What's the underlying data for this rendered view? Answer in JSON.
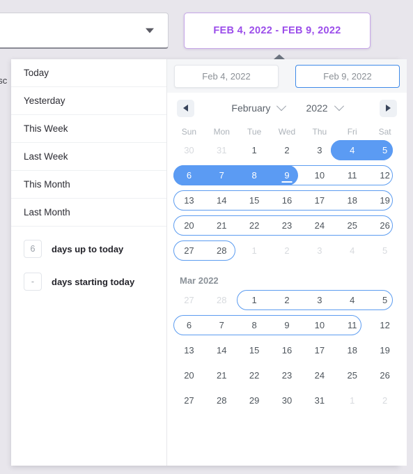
{
  "background": {
    "select_caret_icon": "chevron-down-icon",
    "obscured_text": "esc",
    "range_badge_label": "FEB 4, 2022 - FEB 9, 2022",
    "badge_accent_color": "#9b4dea"
  },
  "popup": {
    "presets": [
      {
        "label": "Today"
      },
      {
        "label": "Yesterday"
      },
      {
        "label": "This Week"
      },
      {
        "label": "Last Week"
      },
      {
        "label": "This Month"
      },
      {
        "label": "Last Month"
      }
    ],
    "relative_rows": [
      {
        "value": "6",
        "label": "days up to today"
      },
      {
        "value": "-",
        "label": "days starting today"
      }
    ],
    "date_fields": {
      "start": {
        "value": "Feb 4, 2022",
        "active": false
      },
      "end": {
        "value": "Feb 9, 2022",
        "active": true
      }
    },
    "nav": {
      "prev_icon": "chevron-left-icon",
      "next_icon": "chevron-right-icon",
      "month": "February",
      "year": "2022",
      "month_chevron_icon": "chevron-down-icon",
      "year_chevron_icon": "chevron-down-icon"
    },
    "weekdays": [
      "Sun",
      "Mon",
      "Tue",
      "Wed",
      "Thu",
      "Fri",
      "Sat"
    ],
    "accent_selected": "#5b9bf3",
    "accent_ring": "#5c9cf0",
    "months": [
      {
        "title": "",
        "weeks": [
          {
            "days": [
              {
                "n": "30",
                "muted": true
              },
              {
                "n": "31",
                "muted": true
              },
              {
                "n": "1"
              },
              {
                "n": "2"
              },
              {
                "n": "3"
              },
              {
                "n": "4",
                "selected": true
              },
              {
                "n": "5",
                "selected": true
              }
            ],
            "fill": {
              "from": 5,
              "to": 6
            },
            "ring": {
              "from": 5,
              "to": 6
            }
          },
          {
            "days": [
              {
                "n": "6",
                "selected": true
              },
              {
                "n": "7",
                "selected": true
              },
              {
                "n": "8",
                "selected": true
              },
              {
                "n": "9",
                "selected": true,
                "today": true
              },
              {
                "n": "10"
              },
              {
                "n": "11"
              },
              {
                "n": "12"
              }
            ],
            "fill": {
              "from": 0,
              "to": 3
            },
            "ring": {
              "from": 0,
              "to": 6
            }
          },
          {
            "days": [
              {
                "n": "13"
              },
              {
                "n": "14"
              },
              {
                "n": "15"
              },
              {
                "n": "16"
              },
              {
                "n": "17"
              },
              {
                "n": "18"
              },
              {
                "n": "19"
              }
            ],
            "ring": {
              "from": 0,
              "to": 6
            }
          },
          {
            "days": [
              {
                "n": "20"
              },
              {
                "n": "21"
              },
              {
                "n": "22"
              },
              {
                "n": "23"
              },
              {
                "n": "24"
              },
              {
                "n": "25"
              },
              {
                "n": "26"
              }
            ],
            "ring": {
              "from": 0,
              "to": 6
            }
          },
          {
            "days": [
              {
                "n": "27"
              },
              {
                "n": "28"
              },
              {
                "n": "1",
                "muted": true
              },
              {
                "n": "2",
                "muted": true
              },
              {
                "n": "3",
                "muted": true
              },
              {
                "n": "4",
                "muted": true
              },
              {
                "n": "5",
                "muted": true
              }
            ],
            "ring": {
              "from": 0,
              "to": 1
            }
          }
        ]
      },
      {
        "title": "Mar 2022",
        "weeks": [
          {
            "days": [
              {
                "n": "27",
                "muted": true
              },
              {
                "n": "28",
                "muted": true
              },
              {
                "n": "1"
              },
              {
                "n": "2"
              },
              {
                "n": "3"
              },
              {
                "n": "4"
              },
              {
                "n": "5"
              }
            ],
            "ring": {
              "from": 2,
              "to": 6
            }
          },
          {
            "days": [
              {
                "n": "6"
              },
              {
                "n": "7"
              },
              {
                "n": "8"
              },
              {
                "n": "9"
              },
              {
                "n": "10"
              },
              {
                "n": "11"
              },
              {
                "n": "12"
              }
            ],
            "ring": {
              "from": 0,
              "to": 5
            }
          },
          {
            "days": [
              {
                "n": "13"
              },
              {
                "n": "14"
              },
              {
                "n": "15"
              },
              {
                "n": "16"
              },
              {
                "n": "17"
              },
              {
                "n": "18"
              },
              {
                "n": "19"
              }
            ]
          },
          {
            "days": [
              {
                "n": "20"
              },
              {
                "n": "21"
              },
              {
                "n": "22"
              },
              {
                "n": "23"
              },
              {
                "n": "24"
              },
              {
                "n": "25"
              },
              {
                "n": "26"
              }
            ]
          },
          {
            "days": [
              {
                "n": "27"
              },
              {
                "n": "28"
              },
              {
                "n": "29"
              },
              {
                "n": "30"
              },
              {
                "n": "31"
              },
              {
                "n": "1",
                "muted": true
              },
              {
                "n": "2",
                "muted": true
              }
            ]
          }
        ]
      }
    ]
  }
}
